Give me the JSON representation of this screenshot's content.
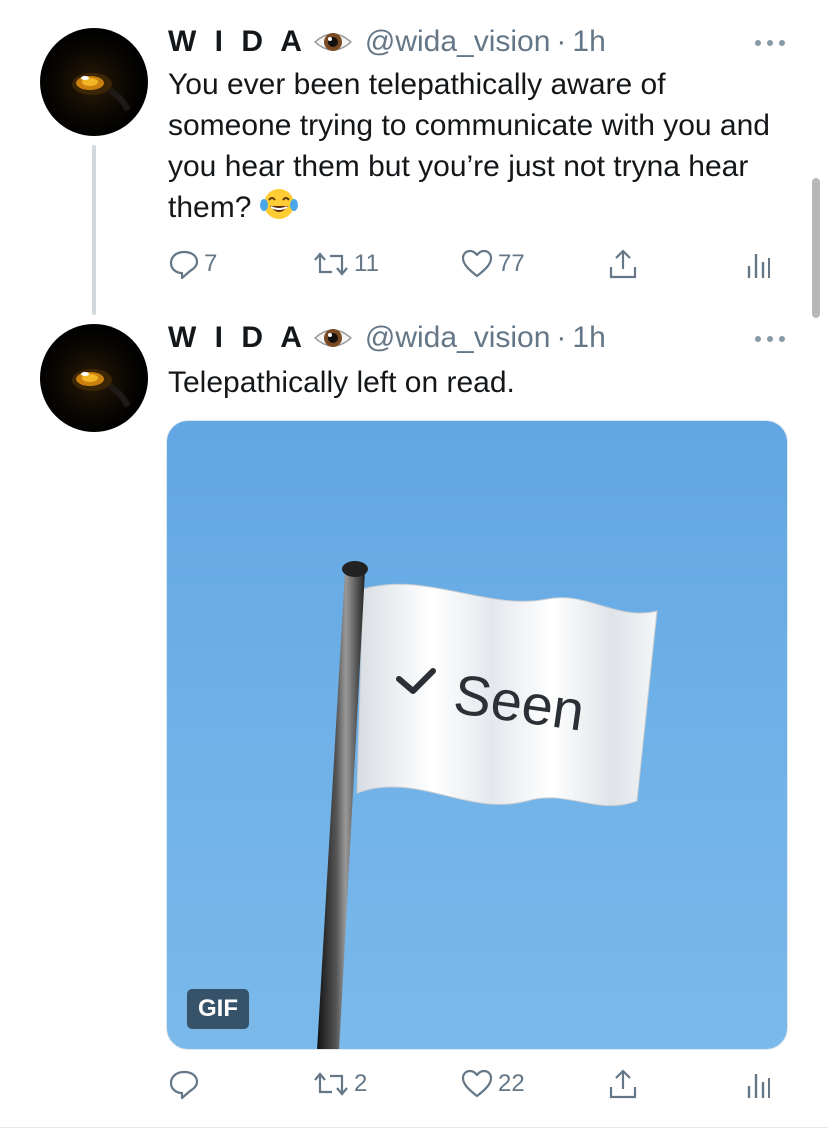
{
  "tweets": [
    {
      "author_name": "W I D A",
      "author_emoji": "eye-emoji",
      "handle": "@wida_vision",
      "separator": "·",
      "time": "1h",
      "text": "You ever been telepathically aware of someone trying to communicate with you and you hear them but you’re just not tryna hear them?",
      "text_emoji": "face-with-tears-of-joy-emoji",
      "replies": "7",
      "retweets": "11",
      "likes": "77"
    },
    {
      "author_name": "W I D A",
      "author_emoji": "eye-emoji",
      "handle": "@wida_vision",
      "separator": "·",
      "time": "1h",
      "text": "Telepathically left on read.",
      "media": {
        "flag_text": "Seen",
        "badge": "GIF"
      },
      "replies": "",
      "retweets": "2",
      "likes": "22"
    }
  ],
  "icons": {
    "reply": "reply-icon",
    "retweet": "retweet-icon",
    "like": "heart-icon",
    "share": "share-icon",
    "analytics": "analytics-icon",
    "more": "more-icon"
  },
  "colors": {
    "text_primary": "#14171a",
    "text_secondary": "#657786",
    "thread_line": "#cfd9de",
    "sky": "#6fb1e8"
  }
}
